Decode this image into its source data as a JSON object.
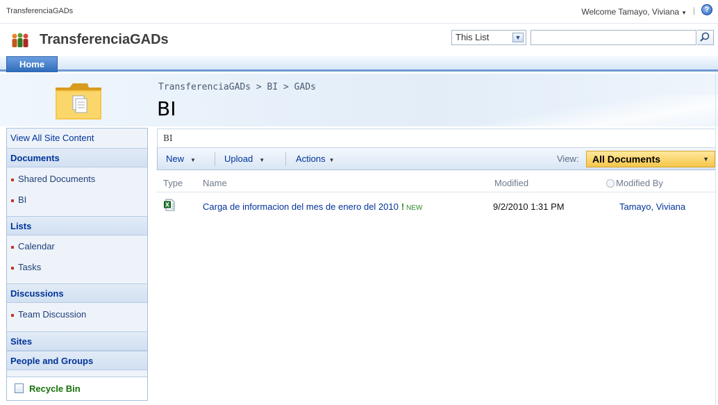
{
  "topbar": {
    "site_link": "TransferenciaGADs",
    "welcome": "Welcome Tamayo, Viviana",
    "separator": "|",
    "help_icon": "help-icon"
  },
  "titlebar": {
    "site_title": "TransferenciaGADs",
    "search_scope": "This List",
    "search_value": "",
    "search_icon": "magnifier-icon"
  },
  "topnav": {
    "tabs": [
      {
        "label": "Home"
      }
    ]
  },
  "header": {
    "breadcrumb": "TransferenciaGADs > BI > GADs",
    "page_title": "BI"
  },
  "sidebar": {
    "view_all": "View All Site Content",
    "documents_header": "Documents",
    "documents": [
      "Shared Documents",
      "BI"
    ],
    "lists_header": "Lists",
    "lists": [
      "Calendar",
      "Tasks"
    ],
    "discussions_header": "Discussions",
    "discussions": [
      "Team Discussion"
    ],
    "sites_header": "Sites",
    "people_header": "People and Groups",
    "recycle_bin": "Recycle Bin"
  },
  "list": {
    "title": "BI",
    "toolbar": {
      "new": "New",
      "upload": "Upload",
      "actions": "Actions",
      "view_label": "View:",
      "view_value": "All Documents"
    },
    "columns": {
      "type": "Type",
      "name": "Name",
      "modified": "Modified",
      "modified_by": "Modified By"
    },
    "rows": [
      {
        "type_icon": "excel-document-icon",
        "name": "Carga de informacion del mes de enero del 2010",
        "badge_bang": "!",
        "badge": "NEW",
        "modified": "9/2/2010 1:31 PM",
        "modified_by": "Tamayo, Viviana"
      }
    ]
  },
  "colors": {
    "nav_blue": "#003399",
    "tab_blue": "#2d6ab9",
    "view_gold": "#f5c74a",
    "recycle_green": "#17700a",
    "bullet_red": "#c4362a"
  }
}
